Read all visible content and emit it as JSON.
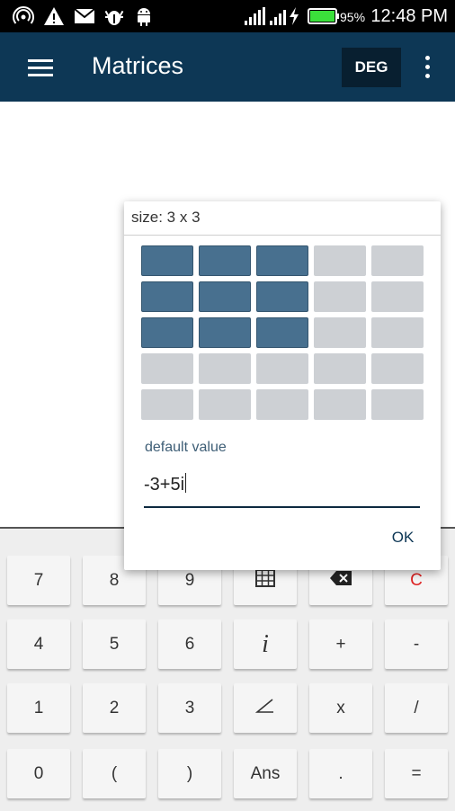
{
  "status_bar": {
    "time": "12:48 PM",
    "battery_percent": "95%",
    "icons": [
      "hotspot-icon",
      "warning-icon",
      "mail-icon",
      "android-debug-icon",
      "android-icon",
      "signal-icon",
      "signal-icon",
      "charging-icon",
      "battery-icon"
    ]
  },
  "app_bar": {
    "title": "Matrices",
    "angle_mode": "DEG",
    "menu_icon": "hamburger-menu-icon",
    "overflow_icon": "more-vert-icon"
  },
  "dialog": {
    "title": "size: 3 x 3",
    "grid": {
      "rows": 5,
      "cols": 5,
      "selected_rows": 3,
      "selected_cols": 3,
      "selected_color": "#48708f",
      "unselected_color": "#cdd0d4"
    },
    "default_value_label": "default value",
    "default_value": "-3+5i",
    "ok_label": "OK"
  },
  "keypad": {
    "rows": [
      [
        "7",
        "8",
        "9",
        "matrix-icon",
        "backspace-icon",
        "C"
      ],
      [
        "4",
        "5",
        "6",
        "i",
        "+",
        "-"
      ],
      [
        "1",
        "2",
        "3",
        "angle-icon",
        "x",
        "/"
      ],
      [
        "0",
        "(",
        ")",
        "Ans",
        ".",
        "="
      ]
    ],
    "clear_color": "#dd2222"
  },
  "colors": {
    "app_bar": "#0d3755",
    "deg_button": "#081f30",
    "status_bar": "#000000"
  }
}
